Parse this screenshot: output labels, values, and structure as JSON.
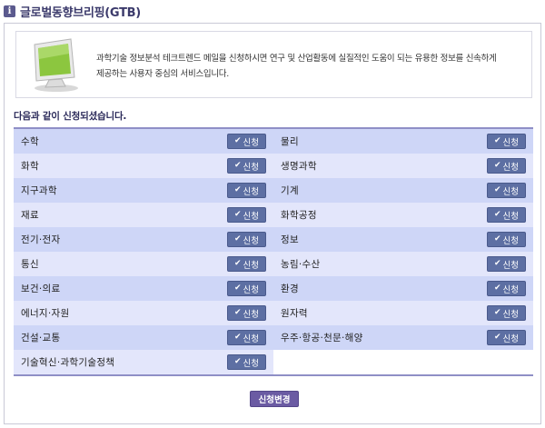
{
  "page": {
    "title": "글로벌동향브리핑(GTB)",
    "title_icon": "info-icon"
  },
  "intro": {
    "icon": "monitor-icon",
    "line1": "과학기술 정보분석 테크트렌드 메일을 신청하시면 연구 및 산업활동에 실질적인 도움이 되는 유용한 정보를 신속하게",
    "line2": "제공하는 사용자 중심의 서비스입니다."
  },
  "subheading": "다음과 같이 신청되셨습니다.",
  "apply_label": "신청",
  "check_icon": "check-icon",
  "categories": [
    {
      "left": "수학",
      "right": "물리"
    },
    {
      "left": "화학",
      "right": "생명과학"
    },
    {
      "left": "지구과학",
      "right": "기계"
    },
    {
      "left": "재료",
      "right": "화학공정"
    },
    {
      "left": "전기·전자",
      "right": "정보"
    },
    {
      "left": "통신",
      "right": "농림·수산"
    },
    {
      "left": "보건·의료",
      "right": "환경"
    },
    {
      "left": "에너지·자원",
      "right": "원자력"
    },
    {
      "left": "건설·교통",
      "right": "우주·항공·천문·해양"
    },
    {
      "left": "기술혁신·과학기술정책",
      "right": ""
    }
  ],
  "change_button": "신청변경",
  "colors": {
    "row_odd": "#ced6f7",
    "row_even": "#e3e6fb",
    "apply_button": "#5d6fa3",
    "change_button": "#6b5ba3",
    "border": "#8f8fc6"
  }
}
